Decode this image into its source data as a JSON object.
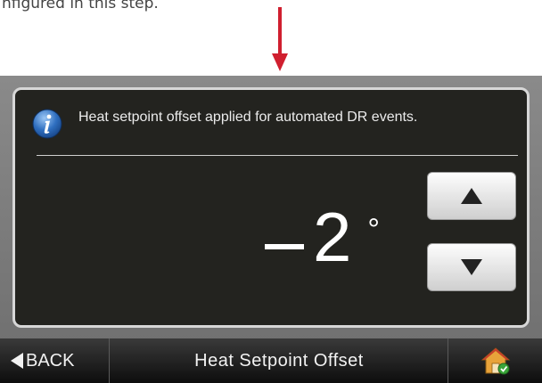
{
  "caption": "nfigured in this step.",
  "info": {
    "icon": "info-icon",
    "text": "Heat setpoint offset applied for automated DR events."
  },
  "setting": {
    "sign": "negative",
    "value": "2",
    "unit": "°"
  },
  "controls": {
    "increase_icon": "up-triangle-icon",
    "decrease_icon": "down-triangle-icon"
  },
  "bottom_bar": {
    "back_label": "BACK",
    "title": "Heat Setpoint Offset",
    "home_icon": "home-icon"
  },
  "colors": {
    "annotation_arrow": "#d01f2f",
    "screen_background": "#23231f",
    "info_icon_blue": "#2f6fc0"
  }
}
